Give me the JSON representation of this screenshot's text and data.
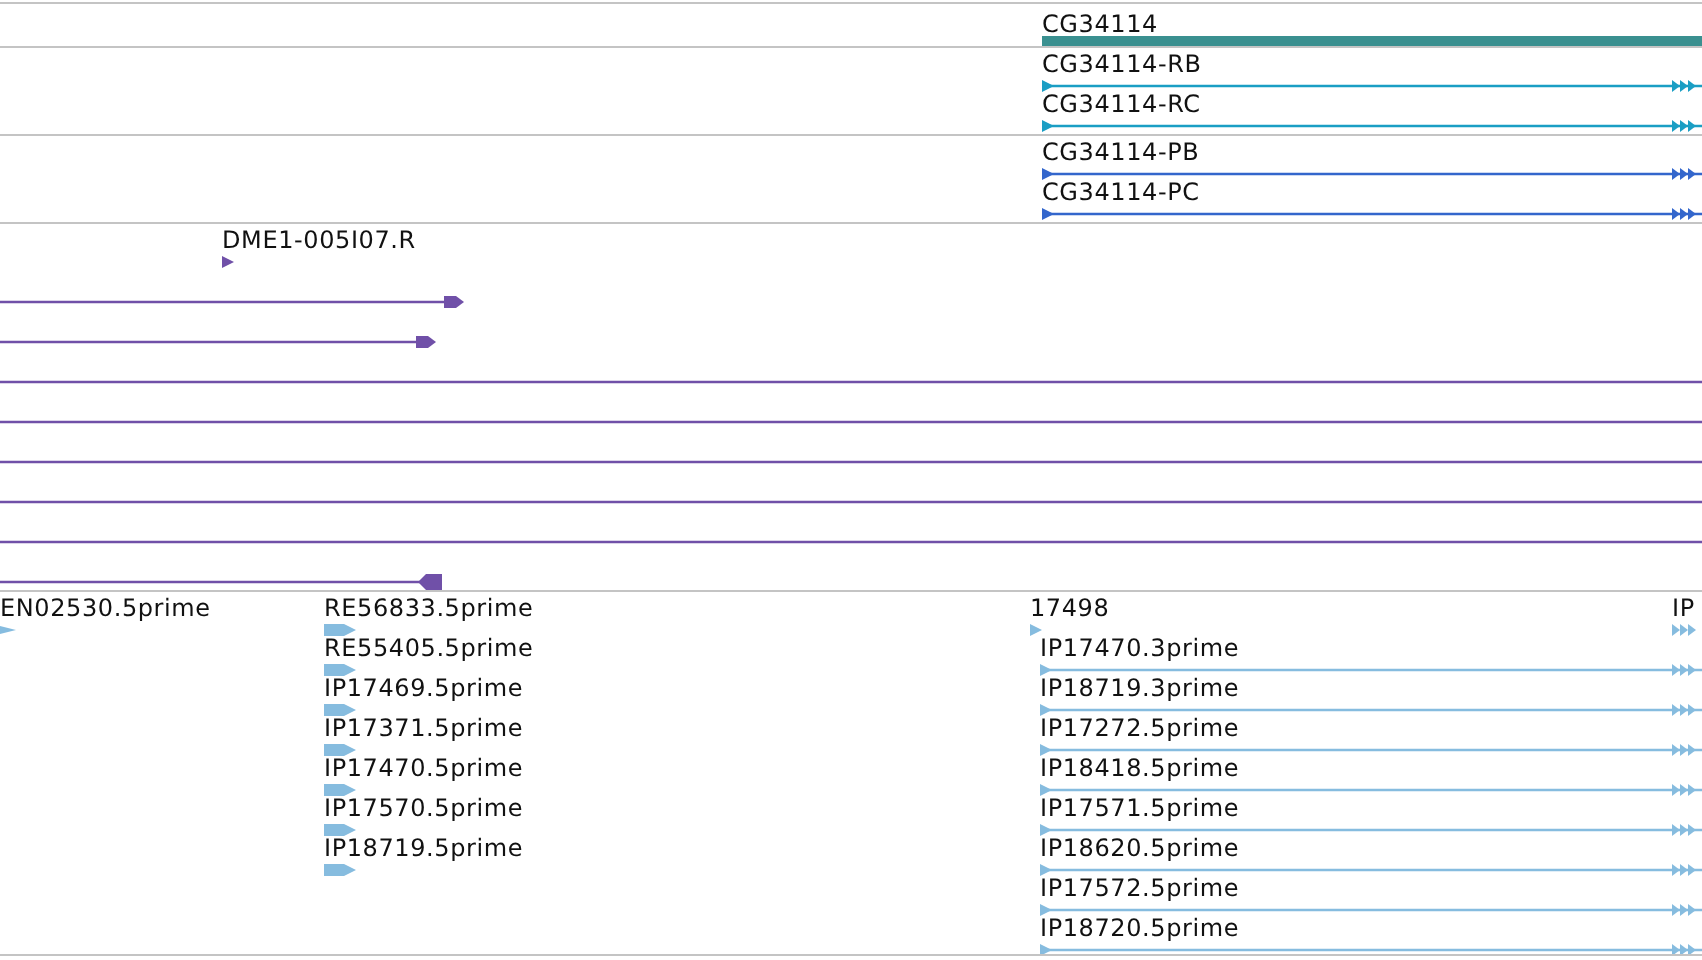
{
  "tracks": [
    {
      "kind": "gene",
      "color": "#3a9090",
      "features": [
        {
          "label": "CG34114"
        }
      ]
    },
    {
      "kind": "transcript",
      "color": "#1a9ec4",
      "features": [
        {
          "label": "CG34114-RB"
        },
        {
          "label": "CG34114-RC"
        }
      ]
    },
    {
      "kind": "protein",
      "color": "#3366cc",
      "features": [
        {
          "label": "CG34114-PB"
        },
        {
          "label": "CG34114-PC"
        }
      ]
    },
    {
      "kind": "alignment",
      "color": "#7050a8",
      "features": [
        {
          "label": "DME1-005I07.R"
        }
      ]
    },
    {
      "kind": "read",
      "color": "#86bcdf",
      "features": [
        {
          "label": "EN02530.5prime"
        },
        {
          "label": "RE56833.5prime"
        },
        {
          "label": "RE55405.5prime"
        },
        {
          "label": "IP17469.5prime"
        },
        {
          "label": "IP17371.5prime"
        },
        {
          "label": "IP17470.5prime"
        },
        {
          "label": "IP17570.5prime"
        },
        {
          "label": "IP18719.5prime"
        },
        {
          "label": "17498"
        },
        {
          "label": "IP17470.3prime"
        },
        {
          "label": "IP18719.3prime"
        },
        {
          "label": "IP17272.5prime"
        },
        {
          "label": "IP18418.5prime"
        },
        {
          "label": "IP17571.5prime"
        },
        {
          "label": "IP18620.5prime"
        },
        {
          "label": "IP17572.5prime"
        },
        {
          "label": "IP18720.5prime"
        },
        {
          "label": "IP"
        }
      ]
    }
  ]
}
